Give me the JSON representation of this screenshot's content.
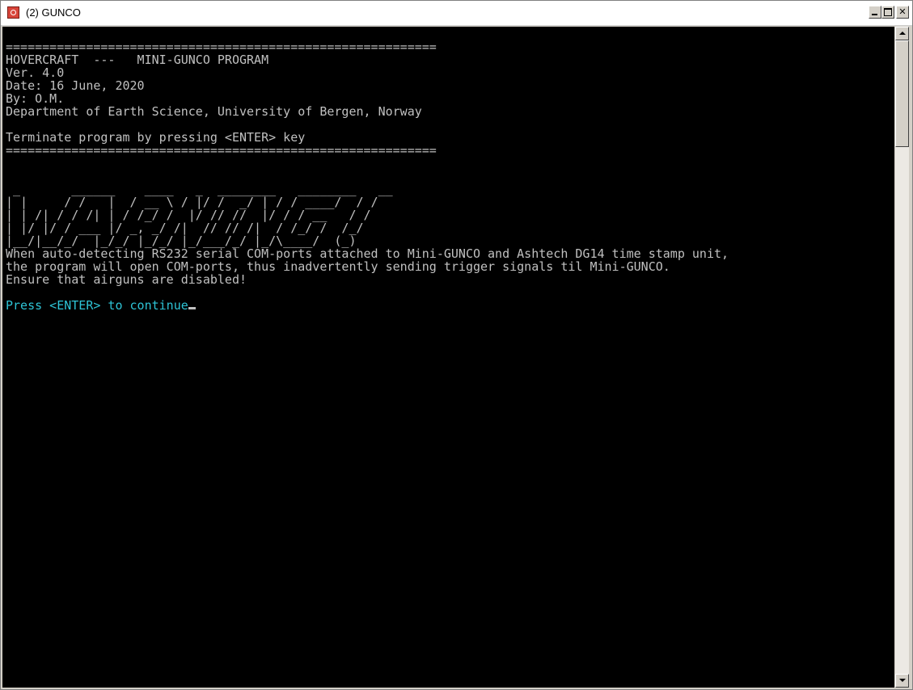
{
  "window": {
    "title": "(2) GUNCO"
  },
  "console": {
    "banner": "===========================================================\nHOVERCRAFT  ---   MINI-GUNCO PROGRAM\nVer. 4.0\nDate: 16 June, 2020\nBy: O.M.\nDepartment of Earth Science, University of Bergen, Norway\n\nTerminate program by pressing <ENTER> key\n===========================================================\n\n\n _       ______    ____   _  ________   ________   __\n| |     / /   |  / __ \\ / |/ /  _/ | / / ____/  / /\n| | /| / / /| | / /_/ /  |/ // //  |/ / / __   / /\n| |/ |/ / ___ |/ _, _/ /|  // // /|  / /_/ /  /_/\n|__/|__/_/  |_/_/ |_/_/ |_/___/_/ |_/\\____/  (_)\n",
    "message": "When auto-detecting RS232 serial COM-ports attached to Mini-GUNCO and Ashtech DG14 time stamp unit,\nthe program will open COM-ports, thus inadvertently sending trigger signals til Mini-GUNCO.\nEnsure that airguns are disabled!\n",
    "prompt": "Press <ENTER> to continue"
  },
  "colors": {
    "console_bg": "#000000",
    "console_text": "#c0c0c0",
    "prompt_text": "#2ec4d6"
  }
}
